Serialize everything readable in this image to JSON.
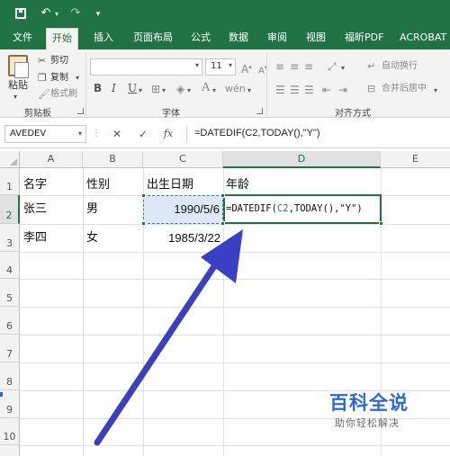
{
  "qat": {
    "save_icon": "save-icon",
    "undo_icon": "undo-icon",
    "redo_icon": "redo-icon"
  },
  "tabs": [
    {
      "label": "文件"
    },
    {
      "label": "开始"
    },
    {
      "label": "插入"
    },
    {
      "label": "页面布局"
    },
    {
      "label": "公式"
    },
    {
      "label": "数据"
    },
    {
      "label": "审阅"
    },
    {
      "label": "视图"
    },
    {
      "label": "福昕PDF"
    },
    {
      "label": "ACROBAT"
    }
  ],
  "ribbon": {
    "clipboard": {
      "paste": "粘贴",
      "cut": "剪切",
      "copy": "复制",
      "format_painter": "格式刷",
      "group": "剪贴板"
    },
    "font": {
      "size": "11",
      "bold": "B",
      "italic": "I",
      "underline": "U",
      "group": "字体"
    },
    "alignment": {
      "wrap": "自动换行",
      "merge": "合并后居中",
      "group": "对齐方式"
    }
  },
  "formula_bar": {
    "name_box": "AVEDEV",
    "cancel": "✕",
    "enter": "✓",
    "fx": "fx",
    "formula": "=DATEDIF(C2,TODAY(),\"Y\")"
  },
  "grid": {
    "columns": [
      "A",
      "B",
      "C",
      "D",
      "E"
    ],
    "rows": [
      "1",
      "2",
      "3",
      "4",
      "5",
      "6",
      "7",
      "8",
      "9",
      "10"
    ],
    "cells": {
      "a1": "名字",
      "b1": "性别",
      "c1": "出生日期",
      "d1": "年龄",
      "a2": "张三",
      "b2": "男",
      "c2": "1990/5/6",
      "a3": "李四",
      "b3": "女",
      "c3": "1985/3/22"
    },
    "d2_formula": {
      "prefix": "=DATEDIF(",
      "ref": "C2",
      "middle": ",TODAY(),",
      "suffix": "\"Y\")"
    }
  },
  "watermark": {
    "title": "百科全说",
    "subtitle": "助你轻松解决"
  },
  "colors": {
    "excel_green": "#217346",
    "arrow_blue": "#3b3fc4",
    "ref_blue": "#3c6bbd"
  }
}
